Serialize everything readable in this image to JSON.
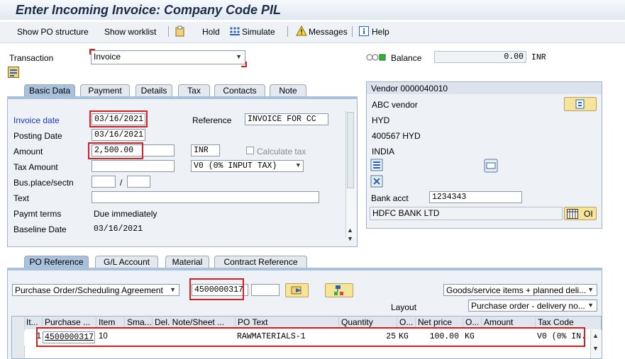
{
  "window": {
    "title": "Enter Incoming Invoice: Company Code PIL"
  },
  "toolbar": {
    "show_po_structure": "Show PO structure",
    "show_worklist": "Show worklist",
    "hold": "Hold",
    "simulate": "Simulate",
    "messages": "Messages",
    "help": "Help"
  },
  "header": {
    "transaction_label": "Transaction",
    "transaction_value": "Invoice",
    "balance_label": "Balance",
    "balance_value": "0.00",
    "balance_currency": "INR"
  },
  "tabs": [
    "Basic Data",
    "Payment",
    "Details",
    "Tax",
    "Contacts",
    "Note"
  ],
  "basic_data": {
    "invoice_date_label": "Invoice date",
    "invoice_date": "03/16/2021",
    "reference_label": "Reference",
    "reference": "INVOICE FOR CC",
    "posting_date_label": "Posting Date",
    "posting_date": "03/16/2021",
    "amount_label": "Amount",
    "amount": "2,500.00",
    "currency": "INR",
    "calculate_tax": "Calculate tax",
    "tax_amount_label": "Tax Amount",
    "tax_code": "V0 (0% INPUT TAX)",
    "bus_place_label": "Bus.place/sectn",
    "slash": "/",
    "text_label": "Text",
    "paymt_terms_label": "Paymt terms",
    "paymt_terms": "Due immediately",
    "baseline_date_label": "Baseline Date",
    "baseline_date": "03/16/2021"
  },
  "vendor": {
    "title": "Vendor 0000040010",
    "name": "ABC vendor",
    "city": "HYD",
    "postal": "400567 HYD",
    "country": "INDIA",
    "bank_acct_label": "Bank acct",
    "bank_acct": "1234343",
    "bank_name": "HDFC BANK LTD",
    "oi_label": "OI"
  },
  "po_tabs": [
    "PO Reference",
    "G/L Account",
    "Material",
    "Contract Reference"
  ],
  "po_ref": {
    "doc_type": "Purchase Order/Scheduling Agreement",
    "po_number": "4500000317",
    "items_select": "Goods/service items + planned deli...",
    "layout_label": "Layout",
    "layout_select": "Purchase order - delivery no..."
  },
  "table": {
    "columns": [
      "It...",
      "Purchase ...",
      "Item",
      "Sma...",
      "Del. Note/Sheet ...",
      "PO Text",
      "Quantity",
      "O...",
      "Net price",
      "O...",
      "Amount",
      "Tax Code"
    ],
    "rows": [
      {
        "it": "1",
        "po": "4500000317",
        "item": "10",
        "sma": "",
        "del": "",
        "po_text": "RAWMATERIALS-1",
        "qty": "25",
        "uom": "KG",
        "net_price": "100.00",
        "uom2": "KG",
        "amount": "",
        "tax_code": "V0 (0% IN..."
      }
    ]
  }
}
